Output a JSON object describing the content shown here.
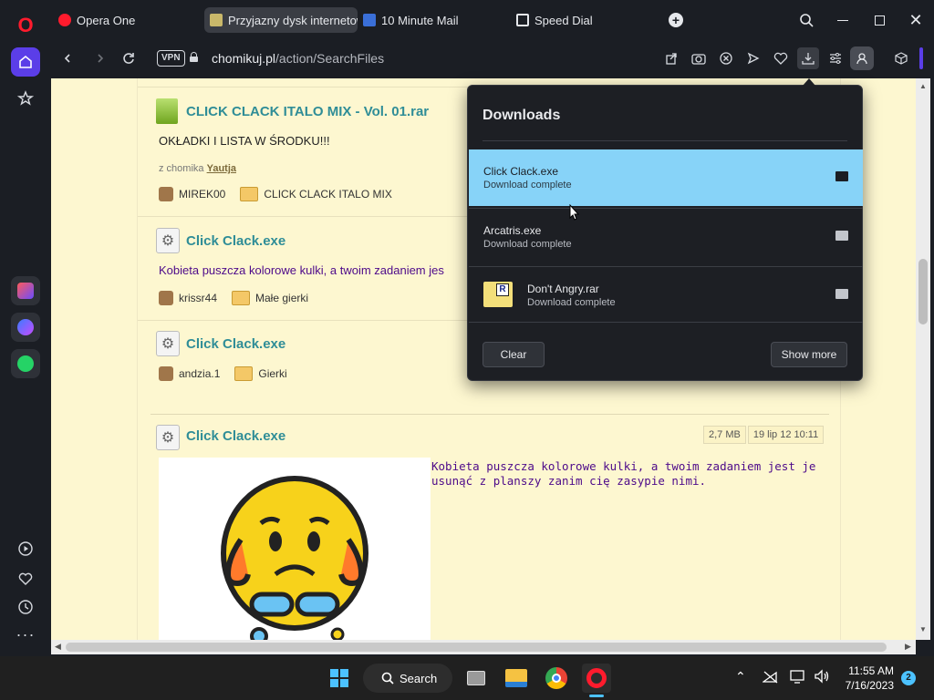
{
  "tabs": [
    {
      "label": "Opera One",
      "active": false
    },
    {
      "label": "Przyjazny dysk internetow",
      "active": true
    },
    {
      "label": "10 Minute Mail",
      "active": false
    },
    {
      "label": "Speed Dial",
      "active": false
    }
  ],
  "address": {
    "vpn": "VPN",
    "domain": "chomikuj.pl",
    "path": "/action/SearchFiles"
  },
  "entries": [
    {
      "title": "CLICK CLACK ITALO MIX - Vol. 01.rar",
      "desc": "OKŁADKI I LISTA W ŚRODKU!!!",
      "from_prefix": "z chomika",
      "from_user": "Yautja",
      "user": "MIREK00",
      "folder": "CLICK CLACK ITALO MIX"
    },
    {
      "title": "Click Clack.exe",
      "desc": "Kobieta puszcza kolorowe kulki, a twoim zadaniem jes",
      "user": "krissr44",
      "folder": "Małe gierki"
    },
    {
      "title": "Click Clack.exe",
      "user": "andzia.1",
      "folder": "Gierki"
    },
    {
      "title": "Click Clack.exe",
      "size": "2,7 MB",
      "date": "19 lip 12 10:11",
      "desc": "Kobieta puszcza kolorowe kulki, a twoim zadaniem jest je usunąć z planszy zanim cię zasypie nimi."
    }
  ],
  "downloads": {
    "title": "Downloads",
    "items": [
      {
        "name": "Click Clack.exe",
        "status": "Download complete"
      },
      {
        "name": "Arcatris.exe",
        "status": "Download complete"
      },
      {
        "name": "Don't Angry.rar",
        "status": "Download complete"
      }
    ],
    "clear_label": "Clear",
    "show_more_label": "Show more"
  },
  "taskbar": {
    "search_label": "Search",
    "time": "11:55 AM",
    "date": "7/16/2023",
    "notifications": "2"
  },
  "colors": {
    "page_bg": "#fdf7d0",
    "link_teal": "#2f8d97",
    "desc_purple": "#4d0a8a",
    "highlight": "#87d3f8"
  }
}
